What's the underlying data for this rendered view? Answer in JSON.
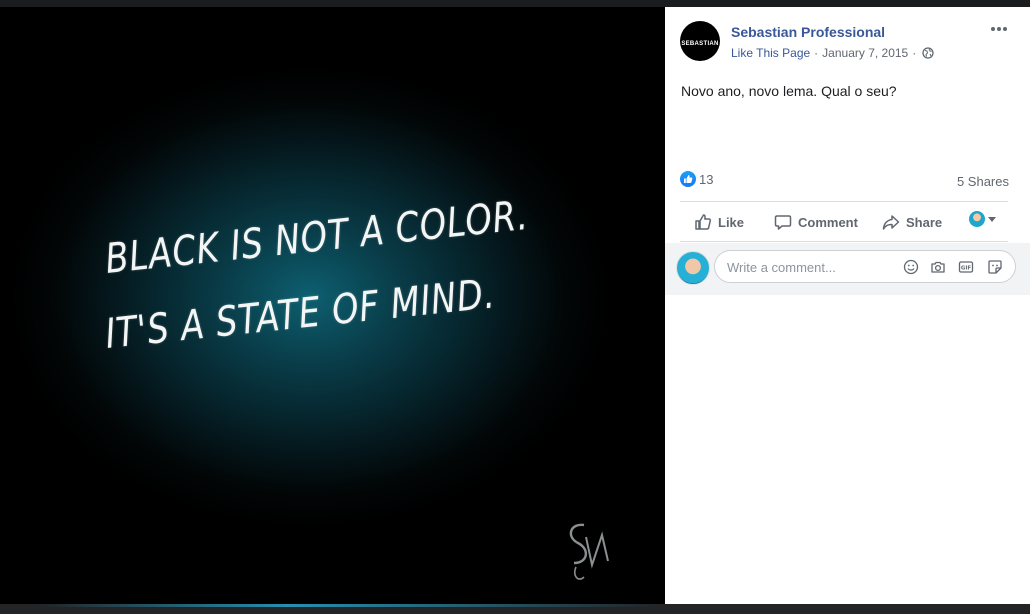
{
  "photo": {
    "quote_line1": "BLACK IS NOT A COLOR.",
    "quote_line2": "IT'S A STATE OF MIND."
  },
  "post": {
    "page_name": "Sebastian Professional",
    "avatar_text": "SEBASTIAN",
    "like_page": "Like This Page",
    "separator": "·",
    "date": "January 7, 2015",
    "audience_icon": "globe-icon",
    "text": "Novo ano, novo lema. Qual o seu?",
    "reaction_count": "13",
    "shares": "5 Shares"
  },
  "actions": {
    "like": "Like",
    "comment": "Comment",
    "share": "Share"
  },
  "comment_box": {
    "placeholder": "Write a comment..."
  },
  "colors": {
    "link": "#385898",
    "like_blue": "#1877f2",
    "text_secondary": "#606770"
  }
}
